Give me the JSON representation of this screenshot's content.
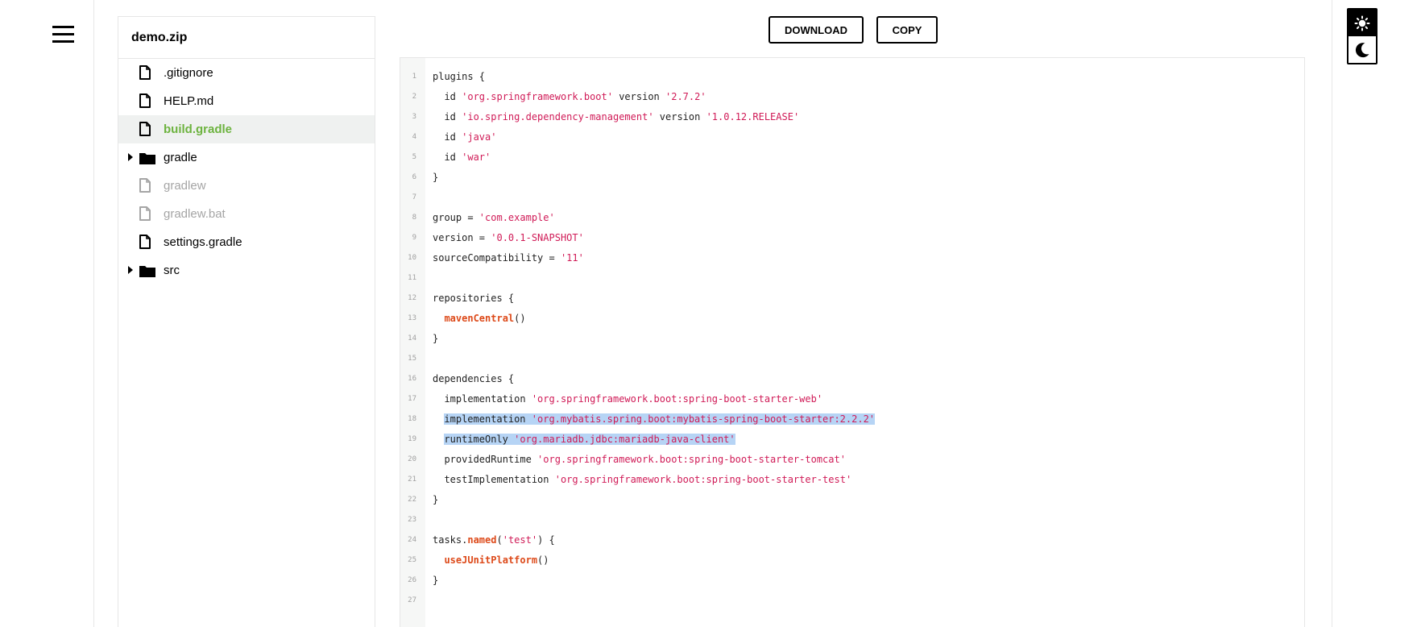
{
  "archive": {
    "name": "demo.zip"
  },
  "actions": {
    "download": "DOWNLOAD",
    "copy": "COPY"
  },
  "tree": [
    {
      "label": ".gitignore",
      "type": "file",
      "state": "normal"
    },
    {
      "label": "HELP.md",
      "type": "file",
      "state": "normal"
    },
    {
      "label": "build.gradle",
      "type": "file",
      "state": "selected"
    },
    {
      "label": "gradle",
      "type": "folder",
      "state": "normal"
    },
    {
      "label": "gradlew",
      "type": "file",
      "state": "dim"
    },
    {
      "label": "gradlew.bat",
      "type": "file",
      "state": "dim"
    },
    {
      "label": "settings.gradle",
      "type": "file",
      "state": "normal"
    },
    {
      "label": "src",
      "type": "folder",
      "state": "normal"
    }
  ],
  "code": {
    "highlighted_lines": [
      18,
      19
    ],
    "lines": [
      [
        "plugins {"
      ],
      [
        "  id ",
        "'org.springframework.boot'",
        " version ",
        "'2.7.2'"
      ],
      [
        "  id ",
        "'io.spring.dependency-management'",
        " version ",
        "'1.0.12.RELEASE'"
      ],
      [
        "  id ",
        "'java'"
      ],
      [
        "  id ",
        "'war'"
      ],
      [
        "}"
      ],
      [
        ""
      ],
      [
        "group = ",
        "'com.example'"
      ],
      [
        "version = ",
        "'0.0.1-SNAPSHOT'"
      ],
      [
        "sourceCompatibility = ",
        "'11'"
      ],
      [
        ""
      ],
      [
        "repositories {"
      ],
      [
        "  ",
        "mavenCentral",
        "()"
      ],
      [
        "}"
      ],
      [
        ""
      ],
      [
        "dependencies {"
      ],
      [
        "  implementation ",
        "'org.springframework.boot:spring-boot-starter-web'"
      ],
      [
        "  implementation ",
        "'org.mybatis.spring.boot:mybatis-spring-boot-starter:2.2.2'"
      ],
      [
        "  runtimeOnly ",
        "'org.mariadb.jdbc:mariadb-java-client'"
      ],
      [
        "  providedRuntime ",
        "'org.springframework.boot:spring-boot-starter-tomcat'"
      ],
      [
        "  testImplementation ",
        "'org.springframework.boot:spring-boot-starter-test'"
      ],
      [
        "}"
      ],
      [
        ""
      ],
      [
        "tasks.",
        "named",
        "(",
        "'test'",
        ") {"
      ],
      [
        "  ",
        "useJUnitPlatform",
        "()"
      ],
      [
        "}"
      ],
      [
        ""
      ]
    ],
    "token_kinds": [
      [
        "plain"
      ],
      [
        "plain",
        "string",
        "plain",
        "string"
      ],
      [
        "plain",
        "string",
        "plain",
        "string"
      ],
      [
        "plain",
        "string"
      ],
      [
        "plain",
        "string"
      ],
      [
        "plain"
      ],
      [
        "plain"
      ],
      [
        "plain",
        "string"
      ],
      [
        "plain",
        "string"
      ],
      [
        "plain",
        "string"
      ],
      [
        "plain"
      ],
      [
        "plain"
      ],
      [
        "plain",
        "function",
        "plain"
      ],
      [
        "plain"
      ],
      [
        "plain"
      ],
      [
        "plain"
      ],
      [
        "plain",
        "string"
      ],
      [
        "plain",
        "string"
      ],
      [
        "plain",
        "string"
      ],
      [
        "plain",
        "string"
      ],
      [
        "plain",
        "string"
      ],
      [
        "plain"
      ],
      [
        "plain"
      ],
      [
        "plain",
        "function",
        "plain",
        "string",
        "plain"
      ],
      [
        "plain",
        "function",
        "plain"
      ],
      [
        "plain"
      ],
      [
        "plain"
      ]
    ]
  },
  "theme": {
    "options": [
      "light",
      "dark"
    ],
    "icons": [
      "sun-icon",
      "moon-icon"
    ]
  },
  "colors": {
    "accent": "#6db33f",
    "string": "#d01b57",
    "function": "#dd4a1a",
    "selection": "#b6d4f5"
  }
}
